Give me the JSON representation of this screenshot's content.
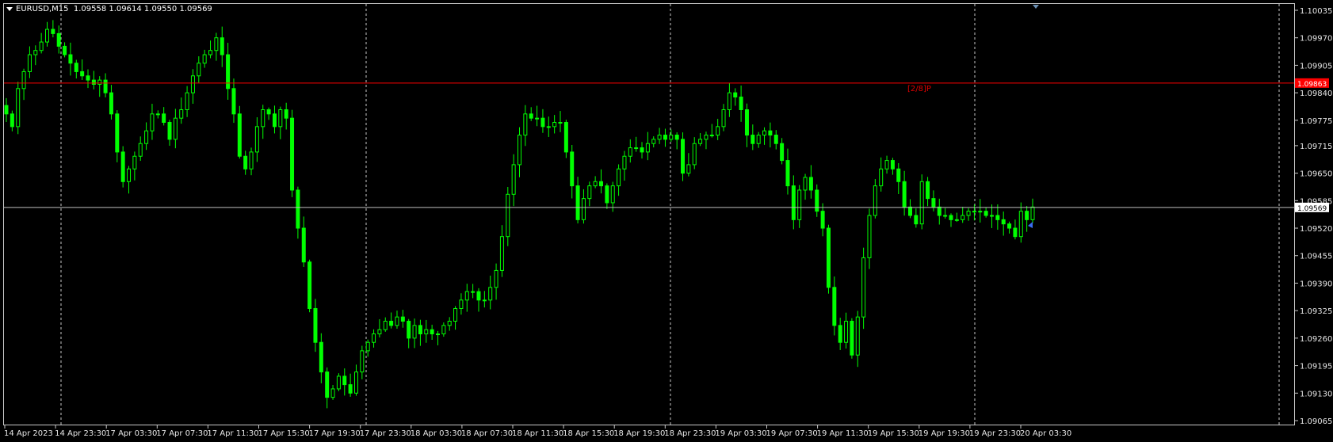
{
  "header": {
    "symbol": "EURUSD,M15",
    "ohlc": "1.09558 1.09614 1.09550 1.09569"
  },
  "chart_data": {
    "type": "candlestick",
    "timeframe": "M15",
    "y_ticks": [
      "1.10035",
      "1.09970",
      "1.09905",
      "1.09840",
      "1.09775",
      "1.09715",
      "1.09650",
      "1.09585",
      "1.09520",
      "1.09455",
      "1.09390",
      "1.09325",
      "1.09260",
      "1.09195",
      "1.09130",
      "1.09065"
    ],
    "ylim": [
      1.09065,
      1.10035
    ],
    "x_ticks": [
      "14 Apr 2023",
      "14 Apr 23:30",
      "17 Apr 03:30",
      "17 Apr 07:30",
      "17 Apr 11:30",
      "17 Apr 15:30",
      "17 Apr 19:30",
      "17 Apr 23:30",
      "18 Apr 03:30",
      "18 Apr 07:30",
      "18 Apr 11:30",
      "18 Apr 15:30",
      "18 Apr 19:30",
      "18 Apr 23:30",
      "19 Apr 03:30",
      "19 Apr 07:30",
      "19 Apr 11:30",
      "19 Apr 15:30",
      "19 Apr 19:30",
      "19 Apr 23:30",
      "20 Apr 03:30"
    ],
    "red_line": {
      "price": 1.09863,
      "label": "1.09863",
      "tag": "[2/8]P",
      "color": "#ff0000"
    },
    "bid_line": {
      "price": 1.09569,
      "label": "1.09569",
      "color": "#c0c0c0"
    },
    "candle_color": "#00ff00",
    "closes": [
      1.0979,
      1.0976,
      1.0985,
      1.0989,
      1.0993,
      1.0994,
      1.0996,
      1.0999,
      1.0998,
      1.0995,
      1.0993,
      1.0991,
      1.0989,
      1.0988,
      1.0987,
      1.0986,
      1.0987,
      1.0984,
      1.0979,
      1.097,
      1.0963,
      1.0966,
      1.0969,
      1.0972,
      1.0975,
      1.0979,
      1.0979,
      1.0977,
      1.0973,
      1.0978,
      1.098,
      1.0984,
      1.0988,
      1.0991,
      1.0993,
      1.0994,
      1.0997,
      1.0993,
      1.0985,
      1.0979,
      1.0969,
      1.0966,
      1.097,
      1.0976,
      1.098,
      1.0979,
      1.0976,
      1.098,
      1.0978,
      1.0961,
      1.0952,
      1.0944,
      1.0933,
      1.0925,
      1.0918,
      1.0912,
      1.0914,
      1.0917,
      1.0915,
      1.0913,
      1.0918,
      1.0923,
      1.0925,
      1.0927,
      1.0928,
      1.093,
      1.0929,
      1.0931,
      1.093,
      1.0926,
      1.0929,
      1.0927,
      1.0928,
      1.0927,
      1.0927,
      1.0929,
      1.093,
      1.0933,
      1.0935,
      1.0937,
      1.0937,
      1.0935,
      1.0935,
      1.0938,
      1.0942,
      1.095,
      1.096,
      1.0967,
      1.0974,
      1.0979,
      1.0978,
      1.0978,
      1.0976,
      1.0976,
      1.0977,
      1.0977,
      1.097,
      1.0962,
      1.0954,
      1.0959,
      1.0962,
      1.0963,
      1.0962,
      1.0958,
      1.0962,
      1.0966,
      1.0969,
      1.0971,
      1.0971,
      1.097,
      1.0972,
      1.0973,
      1.0974,
      1.0973,
      1.0974,
      1.0973,
      1.0965,
      1.0967,
      1.0972,
      1.0973,
      1.0974,
      1.0974,
      1.0976,
      1.098,
      1.0984,
      1.0983,
      1.098,
      1.0974,
      1.0972,
      1.0974,
      1.0975,
      1.0974,
      1.0972,
      1.0968,
      1.0962,
      1.0954,
      1.0961,
      1.0964,
      1.0961,
      1.0956,
      1.0952,
      1.0938,
      1.0929,
      1.0925,
      1.093,
      1.0922,
      1.0931,
      1.0945,
      1.0955,
      1.0962,
      1.0966,
      1.0968,
      1.0966,
      1.0963,
      1.0957,
      1.0955,
      1.0953,
      1.0963,
      1.0959,
      1.0957,
      1.0955,
      1.0955,
      1.0954,
      1.0954,
      1.0955,
      1.0956,
      1.0956,
      1.0956,
      1.0955,
      1.0955,
      1.0954,
      1.0953,
      1.0952,
      1.095,
      1.0956,
      1.0954,
      1.0957
    ]
  }
}
